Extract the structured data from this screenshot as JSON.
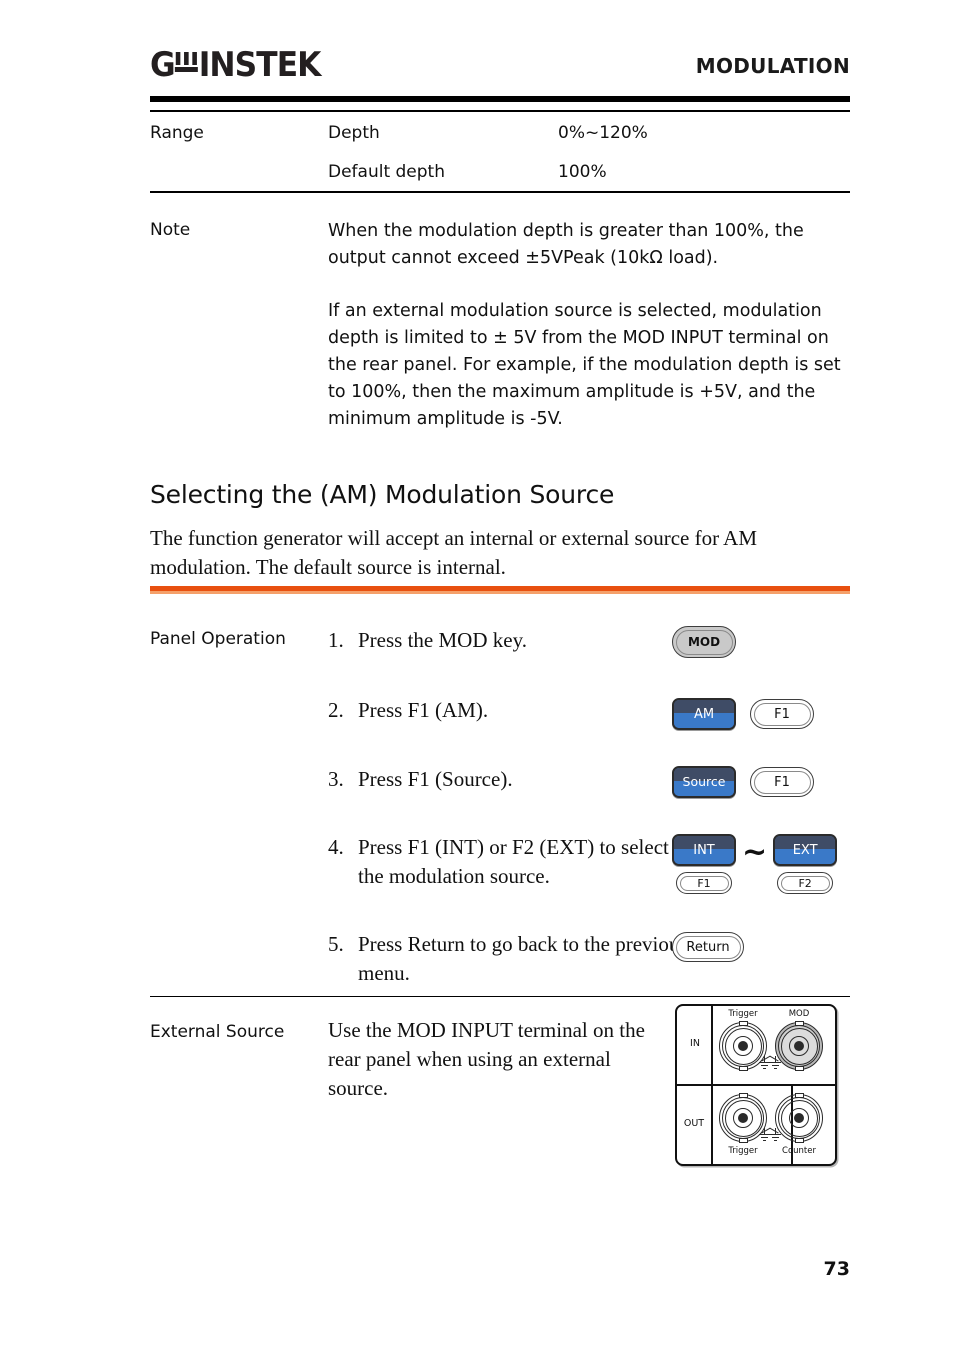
{
  "header": {
    "logo_g": "G",
    "logo_w_icon": "gw-w-mark",
    "logo_rest": "INSTEK",
    "title": "MODULATION"
  },
  "spec_table": {
    "rows": [
      {
        "label": "Range",
        "param": "Depth",
        "value": "0%~120%"
      },
      {
        "label": "",
        "param": "Default depth",
        "value": "100%"
      }
    ]
  },
  "note": {
    "label": "Note",
    "paragraphs": [
      "When the modulation depth is greater than 100%, the output cannot exceed ±5VPeak (10kΩ load).",
      "If an external modulation source is selected, modulation depth is limited to ± 5V from the MOD INPUT terminal on the rear panel. For example, if the modulation depth is set to 100%, then the maximum amplitude is +5V, and the minimum amplitude is -5V."
    ]
  },
  "section": {
    "heading": "Selecting the (AM) Modulation Source",
    "intro": "The function generator will accept an internal or external source for AM modulation. The default source is internal."
  },
  "panel_operation": {
    "label": "Panel Operation",
    "steps": [
      {
        "num": "1.",
        "text": "Press the MOD key."
      },
      {
        "num": "2.",
        "text": "Press F1 (AM)."
      },
      {
        "num": "3.",
        "text": "Press F1 (Source)."
      },
      {
        "num": "4.",
        "text": "Press F1 (INT) or F2 (EXT) to select the modulation source."
      },
      {
        "num": "5.",
        "text": "Press Return to go back to the previous menu."
      }
    ],
    "keys": {
      "mod": "MOD",
      "am": "AM",
      "f1_am": "F1",
      "source": "Source",
      "f1_source": "F1",
      "int": "INT",
      "ext": "EXT",
      "f1_int": "F1",
      "f2_ext": "F2",
      "separator": "~",
      "return": "Return"
    }
  },
  "external_source": {
    "label": "External Source",
    "text": "Use the MOD INPUT terminal on the rear panel when using an external source.",
    "rear_panel": {
      "in_tag": "IN",
      "out_tag": "OUT",
      "connectors": [
        {
          "name": "Trigger",
          "position": "in-left",
          "highlighted": false
        },
        {
          "name": "MOD",
          "position": "in-right",
          "highlighted": true
        },
        {
          "name": "Trigger",
          "position": "out-left",
          "highlighted": false
        },
        {
          "name": "Counter",
          "position": "out-right",
          "highlighted": false
        }
      ]
    }
  },
  "footer": {
    "page_number": "73"
  },
  "colors": {
    "accent_orange": "#E8500F",
    "accent_orange_soft": "#F5A06A",
    "softkey_blue": "#3a79c8",
    "softkey_navy": "#3f4c66",
    "key_gray": "#c9c9c9"
  }
}
